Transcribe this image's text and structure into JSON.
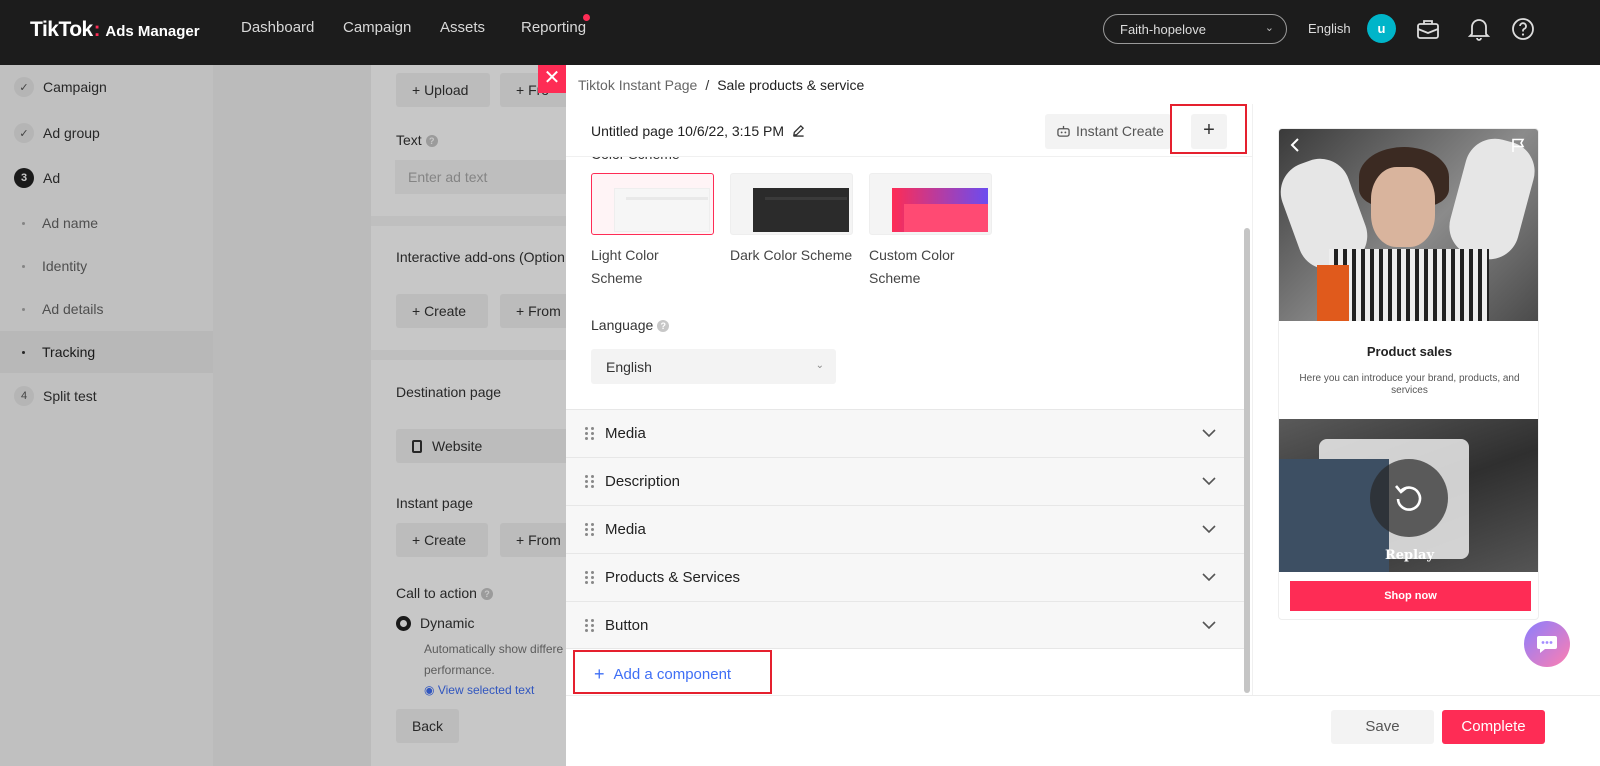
{
  "header": {
    "logo_main": "TikTok",
    "logo_sub": "Ads Manager",
    "nav": [
      "Dashboard",
      "Campaign",
      "Assets",
      "Reporting"
    ],
    "account": "Faith-hopelove",
    "language": "English",
    "avatar_letter": "u"
  },
  "sidebar": {
    "items": [
      {
        "label": "Campaign"
      },
      {
        "label": "Ad group"
      },
      {
        "label": "Ad",
        "number": "3"
      },
      {
        "label": "Ad name"
      },
      {
        "label": "Identity"
      },
      {
        "label": "Ad details"
      },
      {
        "label": "Tracking"
      },
      {
        "label": "Split test",
        "number": "4"
      }
    ]
  },
  "form": {
    "upload": "+ Upload",
    "from_cut": "+ Fro",
    "text_label": "Text",
    "text_placeholder": "Enter ad text",
    "addons_label": "Interactive add-ons (Option",
    "create": "+ Create",
    "from": "+ From",
    "destination_label": "Destination page",
    "website": "Website",
    "instant_page_label": "Instant page",
    "cta_label": "Call to action",
    "dynamic": "Dynamic",
    "dynamic_desc_1": "Automatically show differe",
    "dynamic_desc_2": "performance.",
    "view_selected": "View selected text",
    "back": "Back"
  },
  "drawer": {
    "close": "✕",
    "breadcrumb_parent": "Tiktok Instant Page",
    "breadcrumb_sep": "/",
    "breadcrumb_current": "Sale products & service",
    "page_title": "Untitled page 10/6/22, 3:15 PM",
    "instant_create": "Instant Create",
    "add_button": "+",
    "color_scheme_label": "Color Scheme",
    "schemes": [
      {
        "name_1": "Light Color",
        "name_2": "Scheme"
      },
      {
        "name_1": "Dark Color Scheme",
        "name_2": ""
      },
      {
        "name_1": "Custom Color",
        "name_2": "Scheme"
      }
    ],
    "language_label": "Language",
    "language_value": "English",
    "components": [
      "Media",
      "Description",
      "Media",
      "Products & Services",
      "Button"
    ],
    "add_component": "Add a component",
    "save": "Save",
    "complete": "Complete"
  },
  "preview": {
    "title": "Product sales",
    "description": "Here you can introduce your brand, products, and services",
    "replay": "Replay",
    "shop_now": "Shop now"
  },
  "colors": {
    "brand": "#fe2c55",
    "link": "#3f6ff5",
    "highlight": "#e5202e"
  }
}
